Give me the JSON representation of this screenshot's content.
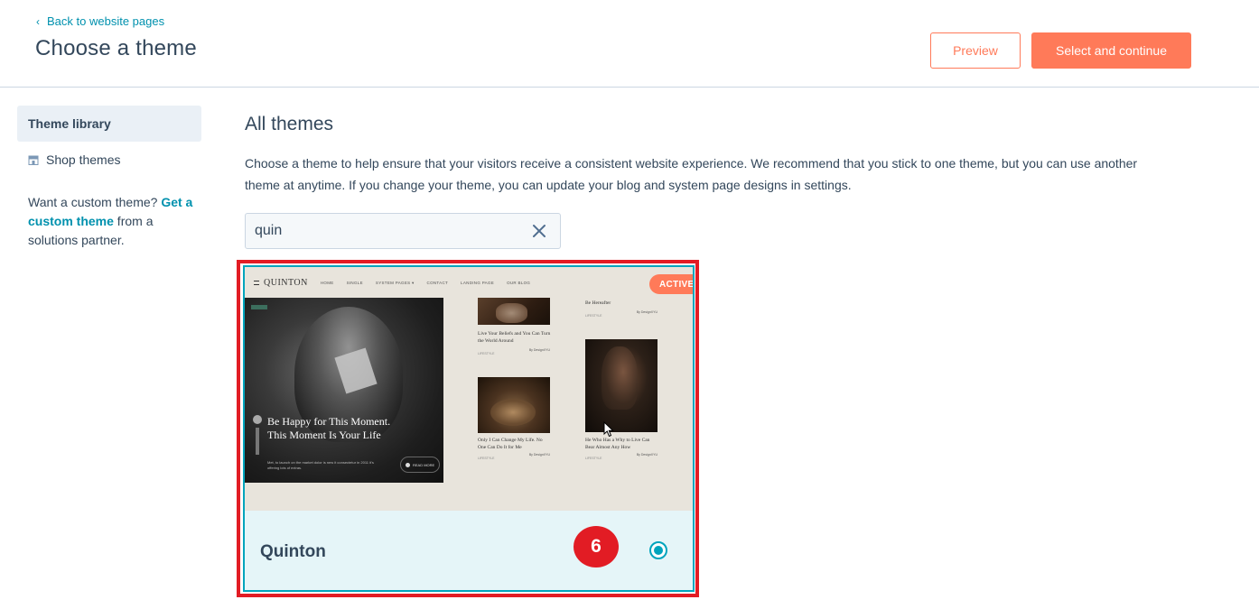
{
  "header": {
    "back_label": "Back to website pages",
    "title": "Choose a theme",
    "preview_label": "Preview",
    "select_label": "Select and continue"
  },
  "sidebar": {
    "items": [
      {
        "label": "Theme library",
        "active": true
      },
      {
        "label": "Shop themes",
        "icon": "store-icon"
      }
    ],
    "note_prefix": "Want a custom theme? ",
    "note_link": "Get a custom theme",
    "note_suffix": " from a solutions partner."
  },
  "main": {
    "title": "All themes",
    "description": "Choose a theme to help ensure that your visitors receive a consistent website experience. We recommend that you stick to one theme, but you can use another theme at anytime. If you change your theme, you can update your blog and system page designs in settings.",
    "search_value": "quin"
  },
  "theme_card": {
    "name": "Quinton",
    "badge": "ACTIVE",
    "selected": true,
    "step_number": "6",
    "preview": {
      "logo": "QUINTON",
      "nav": [
        "HOME",
        "SINGLE",
        "SYSTEM PAGES",
        "CONTACT",
        "LANDING PAGE",
        "OUR BLOG"
      ],
      "hero_tag": "",
      "hero_title": "Be Happy for This Moment. This Moment Is Your Life",
      "hero_sub": "Met, to launch on the market dolor is new it consectetur in 2011 it's offering lots of extras.",
      "hero_more": "READ MORE",
      "posts": [
        {
          "title": "Be Hereafter",
          "meta": "LIFESTYLE",
          "author": "By DesignXYU"
        },
        {
          "title": "Live Your Beliefs and You Can Turn the World Around",
          "meta": "LIFESTYLE",
          "author": "By DesignXYU"
        },
        {
          "title": "Only I Can Change My Life. No One Can Do It for Me",
          "meta": "LIFESTYLE",
          "author": "By DesignXYU"
        },
        {
          "title": "He Who Has a Why to Live Can Bear Almost Any How",
          "meta": "LIFESTYLE",
          "author": "By DesignXYU"
        }
      ]
    }
  },
  "colors": {
    "accent": "#ff7a59",
    "link": "#0091ae",
    "selected_border": "#00a4bd",
    "highlight": "#e21c24",
    "text": "#33475b"
  }
}
